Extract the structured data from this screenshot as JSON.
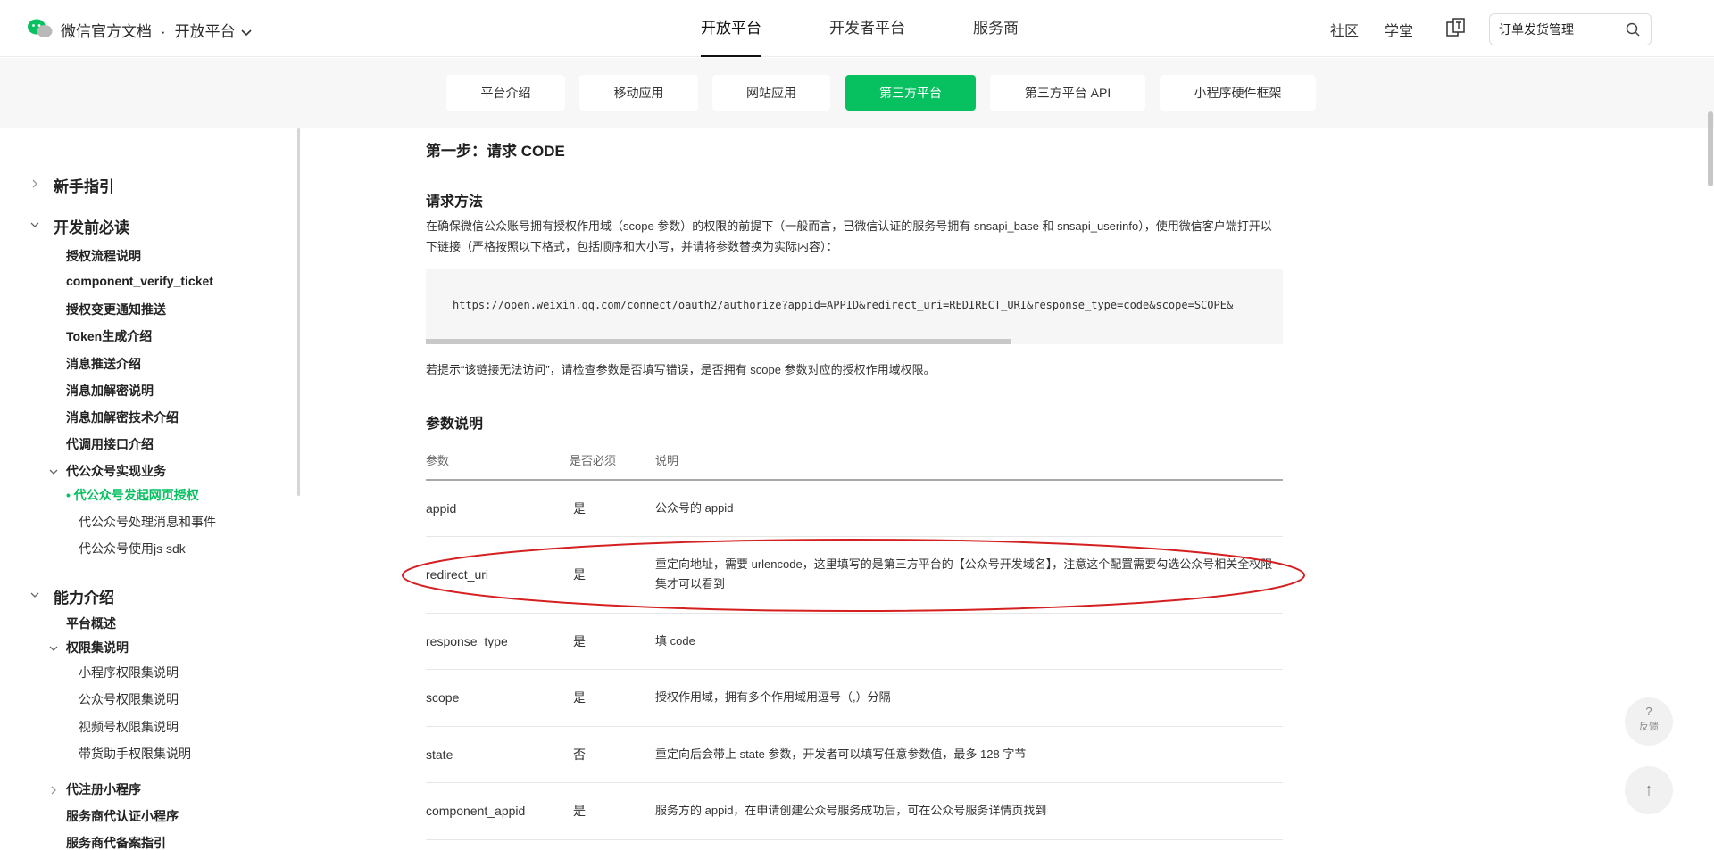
{
  "header": {
    "brand_title": "微信官方文档",
    "brand_sep": "·",
    "platform_label": "开放平台",
    "nav": [
      "开放平台",
      "开发者平台",
      "服务商"
    ],
    "right_links": [
      "社区",
      "学堂"
    ],
    "search_value": "订单发货管理"
  },
  "subnav": {
    "tabs": [
      "平台介绍",
      "移动应用",
      "网站应用",
      "第三方平台",
      "第三方平台 API",
      "小程序硬件框架"
    ]
  },
  "sidebar": {
    "items": [
      {
        "label": "新手指引"
      },
      {
        "label": "开发前必读"
      },
      {
        "label": "授权流程说明"
      },
      {
        "label": "component_verify_ticket"
      },
      {
        "label": "授权变更通知推送"
      },
      {
        "label": "Token生成介绍"
      },
      {
        "label": "消息推送介绍"
      },
      {
        "label": "消息加解密说明"
      },
      {
        "label": "消息加解密技术介绍"
      },
      {
        "label": "代调用接口介绍"
      },
      {
        "label": "代公众号实现业务"
      },
      {
        "label": "代公众号发起网页授权"
      },
      {
        "label": "代公众号处理消息和事件"
      },
      {
        "label": "代公众号使用js sdk"
      },
      {
        "label": "能力介绍"
      },
      {
        "label": "平台概述"
      },
      {
        "label": "权限集说明"
      },
      {
        "label": "小程序权限集说明"
      },
      {
        "label": "公众号权限集说明"
      },
      {
        "label": "视频号权限集说明"
      },
      {
        "label": "带货助手权限集说明"
      },
      {
        "label": "代注册小程序"
      },
      {
        "label": "服务商代认证小程序"
      },
      {
        "label": "服务商代备案指引"
      }
    ]
  },
  "content": {
    "step_title": "第一步：请求 CODE",
    "method_title": "请求方法",
    "method_text": "在确保微信公众账号拥有授权作用域（scope 参数）的权限的前提下（一般而言，已微信认证的服务号拥有 snsapi_base 和 snsapi_userinfo），使用微信客户端打开以下链接（严格按照以下格式，包括顺序和大小写，并请将参数替换为实际内容）：",
    "code_url": "https://open.weixin.qq.com/connect/oauth2/authorize?appid=APPID&redirect_uri=REDIRECT_URI&response_type=code&scope=SCOPE&",
    "hint_text": "若提示“该链接无法访问”，请检查参数是否填写错误，是否拥有 scope 参数对应的授权作用域权限。",
    "params_title": "参数说明",
    "table": {
      "headers": [
        "参数",
        "是否必须",
        "说明"
      ],
      "rows": [
        {
          "param": "appid",
          "required": "是",
          "desc": "公众号的 appid"
        },
        {
          "param": "redirect_uri",
          "required": "是",
          "desc": "重定向地址，需要 urlencode，这里填写的是第三方平台的【公众号开发域名】，注意这个配置需要勾选公众号相关全权限集才可以看到"
        },
        {
          "param": "response_type",
          "required": "是",
          "desc": "填 code"
        },
        {
          "param": "scope",
          "required": "是",
          "desc": "授权作用域，拥有多个作用域用逗号（,）分隔"
        },
        {
          "param": "state",
          "required": "否",
          "desc": "重定向后会带上 state 参数，开发者可以填写任意参数值，最多 128 字节"
        },
        {
          "param": "component_appid",
          "required": "是",
          "desc": "服务方的 appid，在申请创建公众号服务成功后，可在公众号服务详情页找到"
        }
      ]
    }
  },
  "floating": {
    "feedback_q": "?",
    "feedback_label": "反馈",
    "top_arrow": "↑"
  },
  "colors": {
    "accent": "#07c160",
    "annotation": "#d42020"
  }
}
